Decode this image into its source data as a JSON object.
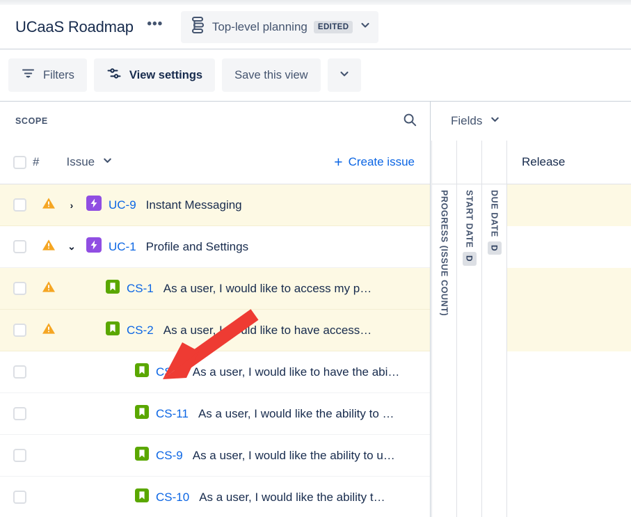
{
  "header": {
    "title": "UCaaS Roadmap",
    "more_label": "•••",
    "view_icon": "plan-stack-icon",
    "view_name": "Top-level planning",
    "edited_badge": "EDITED",
    "chevron": "⌄"
  },
  "toolbar": {
    "filters_label": "Filters",
    "view_settings_label": "View settings",
    "save_view_label": "Save this view",
    "more_chevron": "⌄"
  },
  "scope": {
    "label": "SCOPE",
    "search_icon": "search-icon",
    "hash_label": "#",
    "issue_col_label": "Issue",
    "issue_col_chevron": "⌄",
    "create_issue_label": "Create issue",
    "create_issue_plus": "+"
  },
  "fields": {
    "label": "Fields",
    "chevron": "⌄",
    "release_label": "Release",
    "columns": [
      {
        "label": "PROGRESS (ISSUE COUNT)",
        "badge": ""
      },
      {
        "label": "START DATE",
        "badge": "D"
      },
      {
        "label": "DUE DATE",
        "badge": "D"
      }
    ]
  },
  "rows": [
    {
      "key": "UC-9",
      "summary": "Instant Messaging",
      "type": "epic",
      "level": 1,
      "warning": true,
      "twisty": "›",
      "highlighted": true
    },
    {
      "key": "UC-1",
      "summary": "Profile and Settings",
      "type": "epic",
      "level": 1,
      "warning": true,
      "twisty": "⌄",
      "highlighted": false
    },
    {
      "key": "CS-1",
      "summary": "As a user, I would like to access my p…",
      "type": "story",
      "level": 2,
      "warning": true,
      "twisty": "",
      "highlighted": true
    },
    {
      "key": "CS-2",
      "summary": "As a user, I would like to have access…",
      "type": "story",
      "level": 2,
      "warning": true,
      "twisty": "",
      "highlighted": true
    },
    {
      "key": "CS-8",
      "summary": "As a user, I would like to have the abi…",
      "type": "story",
      "level": 2,
      "warning": false,
      "twisty": "",
      "highlighted": false
    },
    {
      "key": "CS-11",
      "summary": "As a user, I would like the ability to …",
      "type": "story",
      "level": 2,
      "warning": false,
      "twisty": "",
      "highlighted": false
    },
    {
      "key": "CS-9",
      "summary": "As a user, I would like the ability to u…",
      "type": "story",
      "level": 2,
      "warning": false,
      "twisty": "",
      "highlighted": false
    },
    {
      "key": "CS-10",
      "summary": "As a user, I would like the ability t…",
      "type": "story",
      "level": 2,
      "warning": false,
      "twisty": "",
      "highlighted": false
    }
  ],
  "annotation": {
    "type": "arrow",
    "color": "#ee3b33",
    "points_at": "CS-8"
  },
  "colors": {
    "link": "#0c66e4",
    "epic": "#904ee2",
    "story": "#5aa700",
    "warning": "#f5a623",
    "row_highlight": "#fdf9e4",
    "text": "#172b4d",
    "muted": "#44546f"
  }
}
